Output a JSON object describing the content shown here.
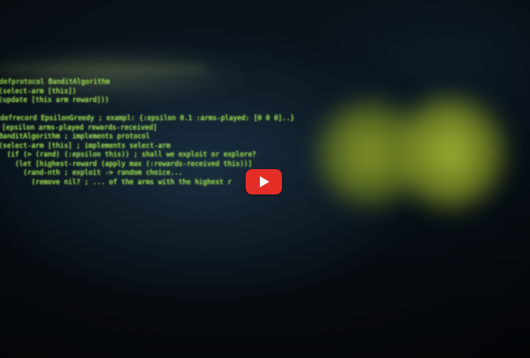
{
  "video": {
    "code_lines": [
      "(defprotocol BanditAlgorithm",
      "  (select-arm [this])",
      "  (update [this arm reward]))",
      "",
      "(defrecord EpsilonGreedy ; exampl: {:epsilon 0.1 :arms-played: [0 0 0]..}",
      "  [epsilon arms-played rewards-received]",
      "  BanditAlgorithm ; implements protocol",
      "  (select-arm [this] ; implements select-arm",
      "    (if (> (rand) (:epsilon this)) ; shall we exploit or explore?",
      "      (let [highest-reward (apply max (:rewards-received this))]",
      "        (rand-nth ; exploit -> random choice...",
      "          (remove nil? ; ... of the arms with the highest r"
    ],
    "play_button": {
      "icon": "play-icon",
      "color": "#e52d27"
    },
    "colors": {
      "code": "#8cc84a",
      "background": "#05090d",
      "bokeh": "#a8bc32"
    }
  }
}
